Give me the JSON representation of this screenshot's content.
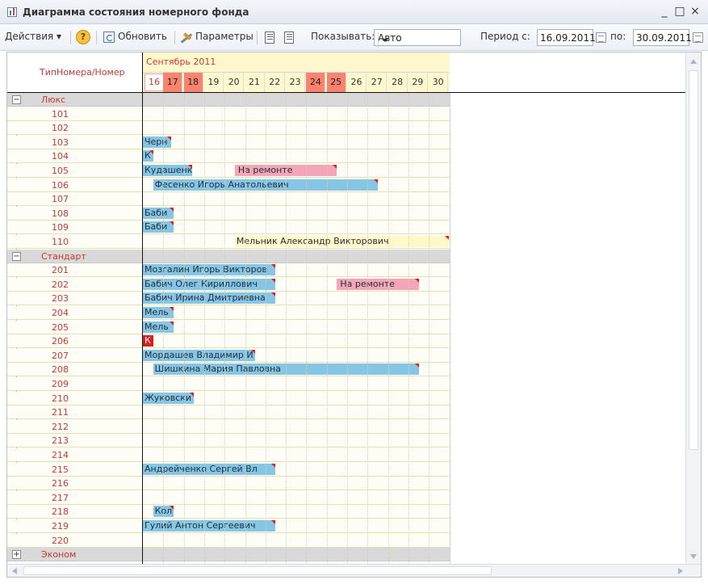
{
  "window": {
    "title": "Диаграмма состояния номерного фонда",
    "minimize_label": "_",
    "maximize_label": "□",
    "close_label": "×"
  },
  "toolbar": {
    "actions_label": "Действия ▾",
    "help_label": "?",
    "refresh_label": "Обновить",
    "params_label": "Параметры",
    "show_label": "Показывать:",
    "show_value": "Авто",
    "period_from_label": "Период с:",
    "period_from_value": "16.09.2011",
    "period_to_label": "по:",
    "period_to_value": "30.09.2011"
  },
  "icons": {
    "help": "help-icon",
    "refresh": "refresh-icon",
    "params": "wrench-icon",
    "copy": "document-copy-icon",
    "calendar": "calendar-icon"
  },
  "colors": {
    "occupied": "#87c5e5",
    "repair": "#f4a6b8",
    "booking": "#fff8c8",
    "weekend": "#f9836e",
    "accent": "#c63a32"
  },
  "chart": {
    "header_left": "ТипНомера/Номер",
    "month": "Сентябрь 2011",
    "days": [
      {
        "label": "16",
        "type": "today"
      },
      {
        "label": "17",
        "type": "weekend"
      },
      {
        "label": "18",
        "type": "weekend"
      },
      {
        "label": "19",
        "type": "normal"
      },
      {
        "label": "20",
        "type": "normal"
      },
      {
        "label": "21",
        "type": "normal"
      },
      {
        "label": "22",
        "type": "normal"
      },
      {
        "label": "23",
        "type": "normal"
      },
      {
        "label": "24",
        "type": "weekend"
      },
      {
        "label": "25",
        "type": "weekend"
      },
      {
        "label": "26",
        "type": "normal"
      },
      {
        "label": "27",
        "type": "normal"
      },
      {
        "label": "28",
        "type": "normal"
      },
      {
        "label": "29",
        "type": "normal"
      },
      {
        "label": "30",
        "type": "normal"
      }
    ],
    "groups": [
      {
        "name": "Люкс",
        "expanded": true,
        "rooms": [
          {
            "number": "101",
            "bars": []
          },
          {
            "number": "102",
            "bars": []
          },
          {
            "number": "103",
            "bars": [
              {
                "label": "Черн",
                "start": 0,
                "days": 1.4,
                "kind": "occupied"
              }
            ]
          },
          {
            "number": "104",
            "bars": [
              {
                "label": "К",
                "start": 0,
                "days": 0.5,
                "kind": "occupied"
              }
            ]
          },
          {
            "number": "105",
            "bars": [
              {
                "label": "Кудашенк",
                "start": 0,
                "days": 2.4,
                "kind": "occupied"
              },
              {
                "label": "На ремонте",
                "start": 4.5,
                "days": 5,
                "kind": "repair"
              }
            ]
          },
          {
            "number": "106",
            "bars": [
              {
                "label": "Фесенко Игорь Анатольевич",
                "start": 0.5,
                "days": 11,
                "kind": "occupied"
              }
            ]
          },
          {
            "number": "107",
            "bars": []
          },
          {
            "number": "108",
            "bars": [
              {
                "label": "Баби",
                "start": 0,
                "days": 1.5,
                "kind": "occupied"
              }
            ]
          },
          {
            "number": "109",
            "bars": [
              {
                "label": "Баби",
                "start": 0,
                "days": 1.5,
                "kind": "occupied"
              }
            ]
          },
          {
            "number": "110",
            "bars": [
              {
                "label": "Мельник Александр Викторович",
                "start": 4.5,
                "days": 10.5,
                "kind": "booking"
              }
            ]
          }
        ]
      },
      {
        "name": "Стандарт",
        "expanded": true,
        "rooms": [
          {
            "number": "201",
            "bars": [
              {
                "label": "Мозгалин Игорь Викторов",
                "start": 0,
                "days": 6.5,
                "kind": "occupied"
              }
            ]
          },
          {
            "number": "202",
            "bars": [
              {
                "label": "Бабич Олег Кириллович",
                "start": 0,
                "days": 6.5,
                "kind": "occupied"
              },
              {
                "label": "На ремонте",
                "start": 9.5,
                "days": 4,
                "kind": "repair"
              }
            ]
          },
          {
            "number": "203",
            "bars": [
              {
                "label": "Бабич Ирина Дмитриевна",
                "start": 0,
                "days": 6.5,
                "kind": "occupied"
              }
            ]
          },
          {
            "number": "204",
            "bars": [
              {
                "label": "Мель",
                "start": 0,
                "days": 1.5,
                "kind": "occupied"
              }
            ]
          },
          {
            "number": "205",
            "bars": [
              {
                "label": "Мель",
                "start": 0,
                "days": 1.5,
                "kind": "occupied"
              }
            ]
          },
          {
            "number": "206",
            "bars": [
              {
                "label": "К",
                "start": 0,
                "days": 0.5,
                "kind": "red"
              }
            ]
          },
          {
            "number": "207",
            "bars": [
              {
                "label": "Мордашев Владимир И",
                "start": 0,
                "days": 5.5,
                "kind": "occupied"
              }
            ]
          },
          {
            "number": "208",
            "bars": [
              {
                "label": "Шишкина  Мария Павловна",
                "start": 0.5,
                "days": 13,
                "kind": "occupied"
              }
            ]
          },
          {
            "number": "209",
            "bars": []
          },
          {
            "number": "210",
            "bars": [
              {
                "label": "Жуковски",
                "start": 0,
                "days": 2.5,
                "kind": "occupied"
              }
            ]
          },
          {
            "number": "211",
            "bars": []
          },
          {
            "number": "212",
            "bars": []
          },
          {
            "number": "213",
            "bars": []
          },
          {
            "number": "214",
            "bars": []
          },
          {
            "number": "215",
            "bars": [
              {
                "label": "Андрейченко Сергей Вл",
                "start": 0,
                "days": 6.5,
                "kind": "occupied"
              }
            ]
          },
          {
            "number": "216",
            "bars": []
          },
          {
            "number": "217",
            "bars": []
          },
          {
            "number": "218",
            "bars": [
              {
                "label": "Кол",
                "start": 0.5,
                "days": 1,
                "kind": "occupied"
              }
            ]
          },
          {
            "number": "219",
            "bars": [
              {
                "label": "Гулий Антон  Сергеевич",
                "start": 0,
                "days": 6.5,
                "kind": "occupied"
              }
            ]
          },
          {
            "number": "220",
            "bars": []
          }
        ]
      },
      {
        "name": "Эконом",
        "expanded": false,
        "rooms": []
      }
    ]
  }
}
